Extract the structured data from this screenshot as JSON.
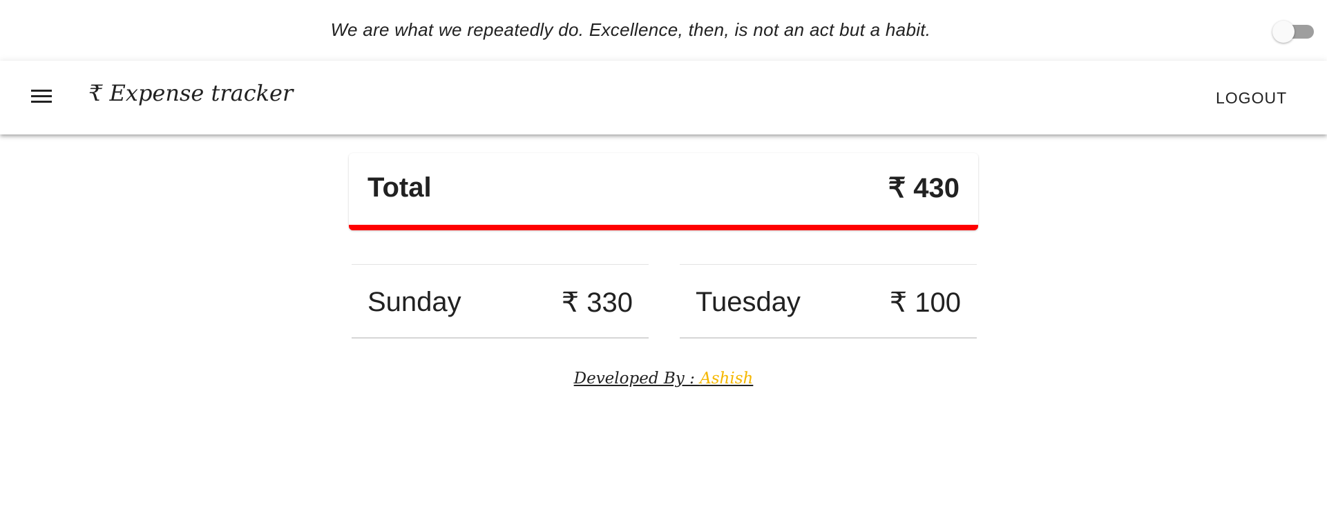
{
  "quote": {
    "text": "We are what we repeatedly do. Excellence, then, is not an act but a habit."
  },
  "theme_toggle": {
    "state": "off"
  },
  "appbar": {
    "menu_icon": "menu-icon",
    "title": "₹ Expense tracker",
    "logout_label": "LOGOUT"
  },
  "summary": {
    "total_label": "Total",
    "total_amount": "₹ 430",
    "accent_color": "#ff0000"
  },
  "days": [
    {
      "name": "Sunday",
      "amount": "₹ 330"
    },
    {
      "name": "Tuesday",
      "amount": "₹ 100"
    }
  ],
  "footer": {
    "prefix": "Developed By : ",
    "author": "Ashish",
    "author_color": "#f5b700"
  }
}
